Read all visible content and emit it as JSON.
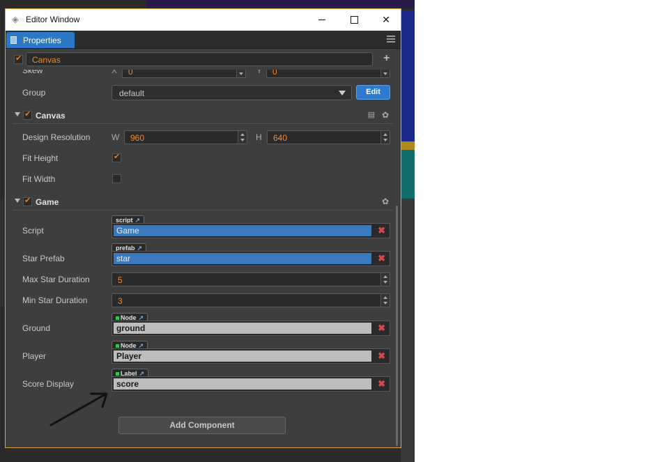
{
  "window": {
    "title": "Editor Window",
    "tab": "Properties"
  },
  "node": {
    "name": "Canvas",
    "enabled": true
  },
  "skew": {
    "label": "Skew",
    "x_label": "X",
    "x_value": "0",
    "y_label": "Y",
    "y_value": "0"
  },
  "group": {
    "label": "Group",
    "value": "default",
    "edit_label": "Edit"
  },
  "canvas_component": {
    "title": "Canvas",
    "enabled": true,
    "design_resolution_label": "Design Resolution",
    "w_label": "W",
    "w_value": "960",
    "h_label": "H",
    "h_value": "640",
    "fit_height_label": "Fit Height",
    "fit_height": true,
    "fit_width_label": "Fit Width",
    "fit_width": false
  },
  "game_component": {
    "title": "Game",
    "enabled": true,
    "script": {
      "label": "Script",
      "tag": "script",
      "value": "Game"
    },
    "star_prefab": {
      "label": "Star Prefab",
      "tag": "prefab",
      "value": "star"
    },
    "max_star_duration": {
      "label": "Max Star Duration",
      "value": "5"
    },
    "min_star_duration": {
      "label": "Min Star Duration",
      "value": "3"
    },
    "ground": {
      "label": "Ground",
      "tag": "Node",
      "value": "ground"
    },
    "player": {
      "label": "Player",
      "tag": "Node",
      "value": "Player"
    },
    "score_display": {
      "label": "Score Display",
      "tag": "Label",
      "value": "score"
    }
  },
  "add_component_label": "Add Component"
}
